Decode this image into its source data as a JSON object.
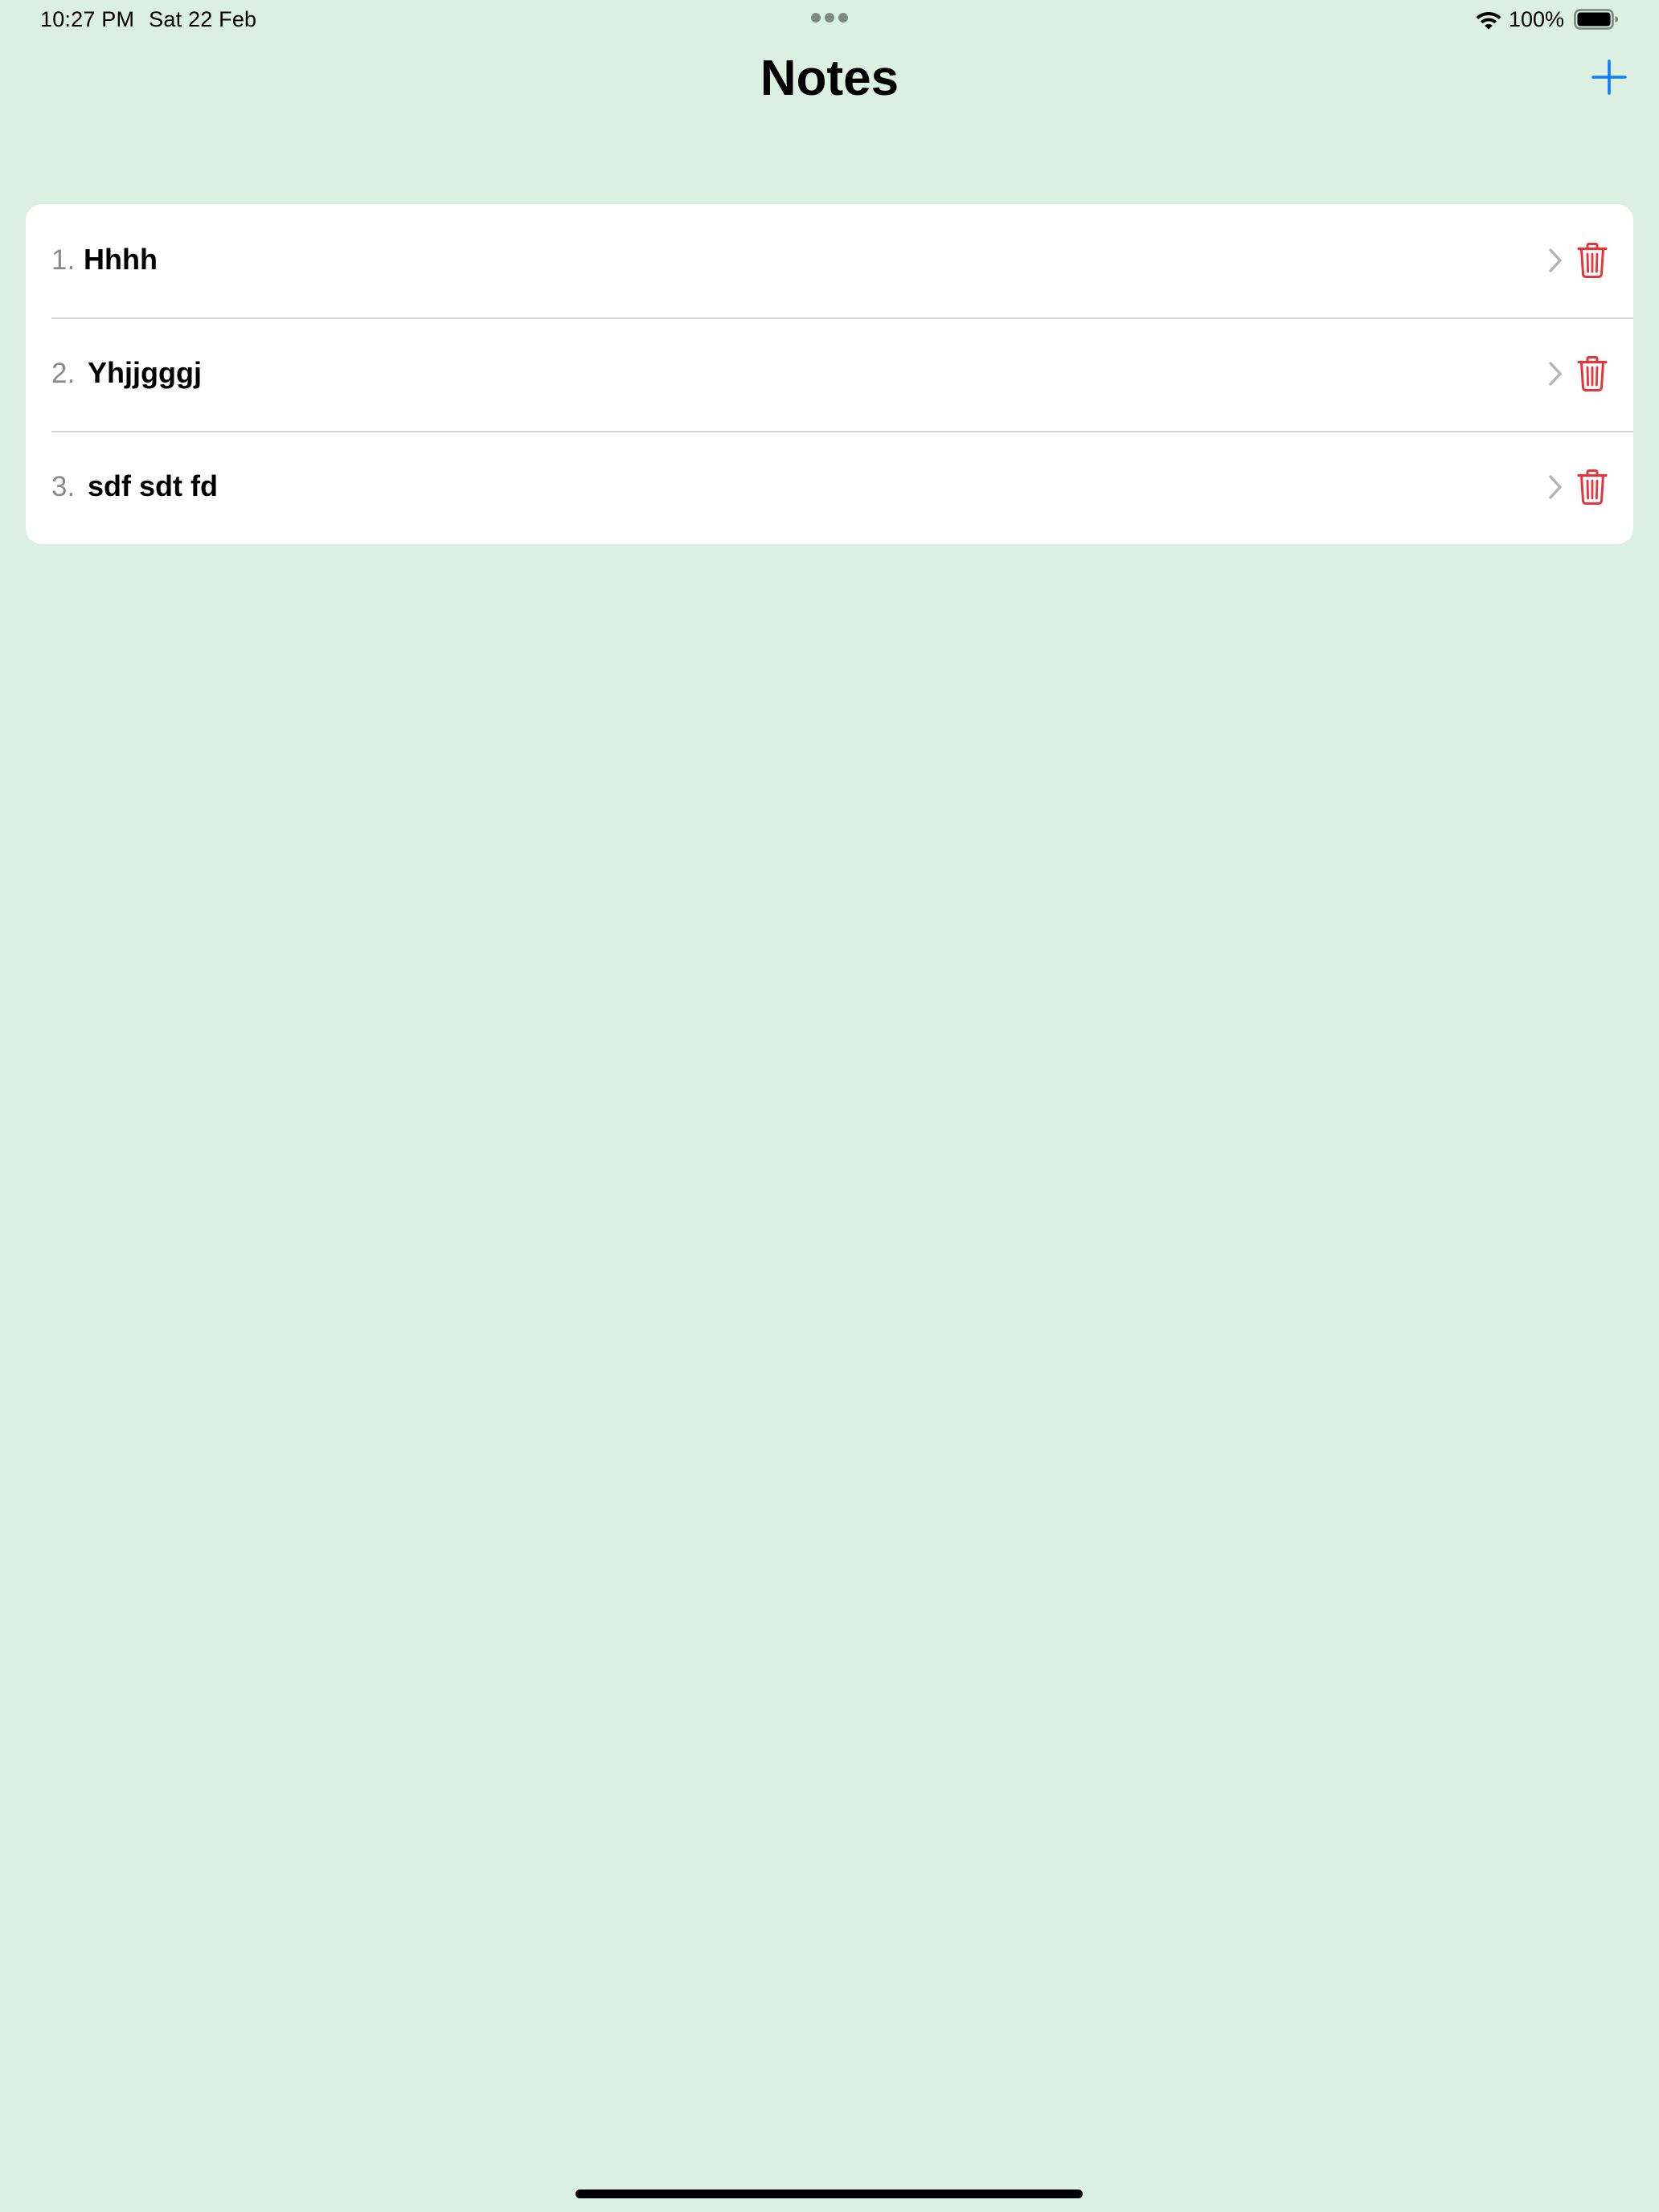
{
  "status_bar": {
    "time": "10:27 PM",
    "date": "Sat 22 Feb",
    "battery_percent": "100%",
    "battery_level": 1.0,
    "icons": [
      "more-dots-icon",
      "wifi-icon",
      "battery-icon"
    ]
  },
  "nav": {
    "title": "Notes",
    "add_icon": "plus-icon"
  },
  "notes": [
    {
      "number": "1.",
      "title": "Hhhh"
    },
    {
      "number": "2.",
      "title": "Yhjjgggj"
    },
    {
      "number": "3.",
      "title": "sdf sdt fd"
    }
  ],
  "row_icons": {
    "disclosure": "chevron-right-icon",
    "delete": "trash-icon"
  },
  "colors": {
    "background": "#dcefe3",
    "card": "#ffffff",
    "accent": "#0a7cff",
    "destructive": "#e5343a",
    "secondary_text": "#8a8a8e"
  }
}
